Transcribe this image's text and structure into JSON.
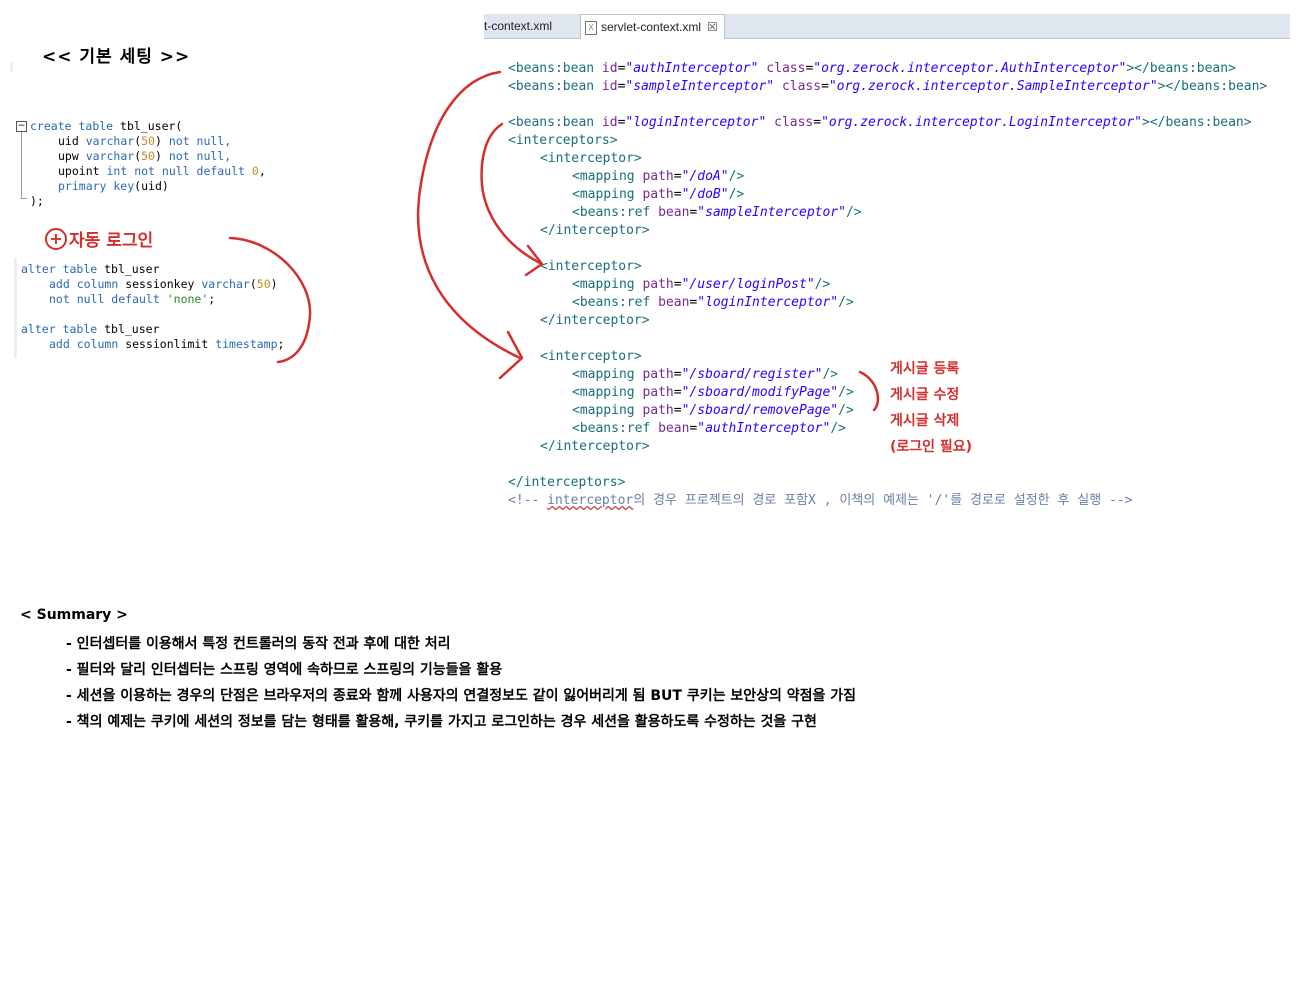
{
  "heading": "<< 기본 세팅 >>",
  "sql_create": {
    "line1": [
      "create",
      " ",
      "table",
      " tbl_user("
    ],
    "rows": [
      {
        "name": "uid",
        "type": "varchar",
        "n": "50",
        "rest": "not null,"
      },
      {
        "name": "upw",
        "type": "varchar",
        "n": "50",
        "rest": "not null,"
      },
      {
        "name": "upoint",
        "type": "int",
        "rest1": "not null default",
        "n": "0",
        "rest2": ","
      },
      {
        "key": "primary key",
        "rest": "(uid)"
      }
    ],
    "close": ");"
  },
  "auto_login_title": "자동 로그인",
  "sql_alter": {
    "a1": {
      "alter": "alter",
      "table": "table",
      "name": " tbl_user"
    },
    "a2": {
      "add": "add",
      "column": "column",
      "col": " sessionkey ",
      "type": "varchar",
      "n": "50"
    },
    "a3": {
      "notnull": "not null default",
      "str": "'none'",
      "end": ";"
    },
    "b1": {
      "alter": "alter",
      "table": "table",
      "name": " tbl_user"
    },
    "b2": {
      "add": "add",
      "column": "column",
      "col": " sessionlimit ",
      "type": "timestamp",
      "end": ";"
    }
  },
  "tabs": {
    "tab1": "t-context.xml",
    "tab2": "servlet-context.xml",
    "icon": "xml-file-icon",
    "close": "☒"
  },
  "xml": {
    "bean1": {
      "tag": "<beans:bean",
      "id_attr": "id",
      "id": "\"authInterceptor\"",
      "class_attr": "class",
      "class": "\"org.zerock.interceptor.AuthInterceptor\"",
      "end": "></beans:bean>"
    },
    "bean2": {
      "tag": "<beans:bean",
      "id_attr": "id",
      "id": "\"sampleInterceptor\"",
      "class_attr": "class",
      "class": "\"org.zerock.interceptor.SampleInterceptor\"",
      "end": "></beans:bean>"
    },
    "bean3": {
      "tag": "<beans:bean",
      "id_attr": "id",
      "id": "\"loginInterceptor\"",
      "class_attr": "class",
      "class": "\"org.zerock.interceptor.LoginInterceptor\"",
      "end": "></beans:bean>"
    },
    "interceptors_open": "<interceptors>",
    "interceptor_open": "<interceptor>",
    "interceptor_close": "</interceptor>",
    "interceptors_close": "</interceptors>",
    "mapping_tag": "<mapping",
    "path_attr": "path",
    "ref_tag": "<beans:ref",
    "bean_attr": "bean",
    "self_close": "/>",
    "group1": {
      "paths": [
        "\"/doA\"",
        "\"/doB\""
      ],
      "ref": "\"sampleInterceptor\""
    },
    "group2": {
      "paths": [
        "\"/user/loginPost\""
      ],
      "ref": "\"loginInterceptor\""
    },
    "group3": {
      "paths": [
        "\"/sboard/register\"",
        "\"/sboard/modifyPage\"",
        "\"/sboard/removePage\""
      ],
      "ref": "\"authInterceptor\""
    },
    "comment_start": "<!-- ",
    "comment_word": "interceptor",
    "comment_rest": "의 경우 프로젝트의 경로 포함X , 이책의 예제는 '/'를 경로로 설정한 후 실행 -->"
  },
  "notes": [
    "게시글 등록",
    "게시글 수정",
    "게시글 삭제",
    "(로그인 필요)"
  ],
  "summary": {
    "title": "< Summary >",
    "bullets": [
      "- 인터셉터를 이용해서 특정 컨트롤러의 동작 전과 후에 대한 처리",
      "- 필터와 달리 인터셉터는 스프링 영역에 속하므로 스프링의 기능들을 활용",
      "- 세션을 이용하는 경우의 단점은 브라우저의 종료와 함께 사용자의 연결정보도 같이 잃어버리게 됨 BUT 쿠키는 보안상의 약점을 가짐",
      "- 책의 예제는 쿠키에 세션의 정보를 담는 형태를 활용해, 쿠키를 가지고 로그인하는 경우 세션을 활용하도록 수정하는 것을 구현"
    ]
  },
  "colors": {
    "annotation_red": "#d32f2f",
    "xml_tag": "#176f7a",
    "xml_attr": "#7b2790",
    "xml_value": "#2a00ff"
  }
}
